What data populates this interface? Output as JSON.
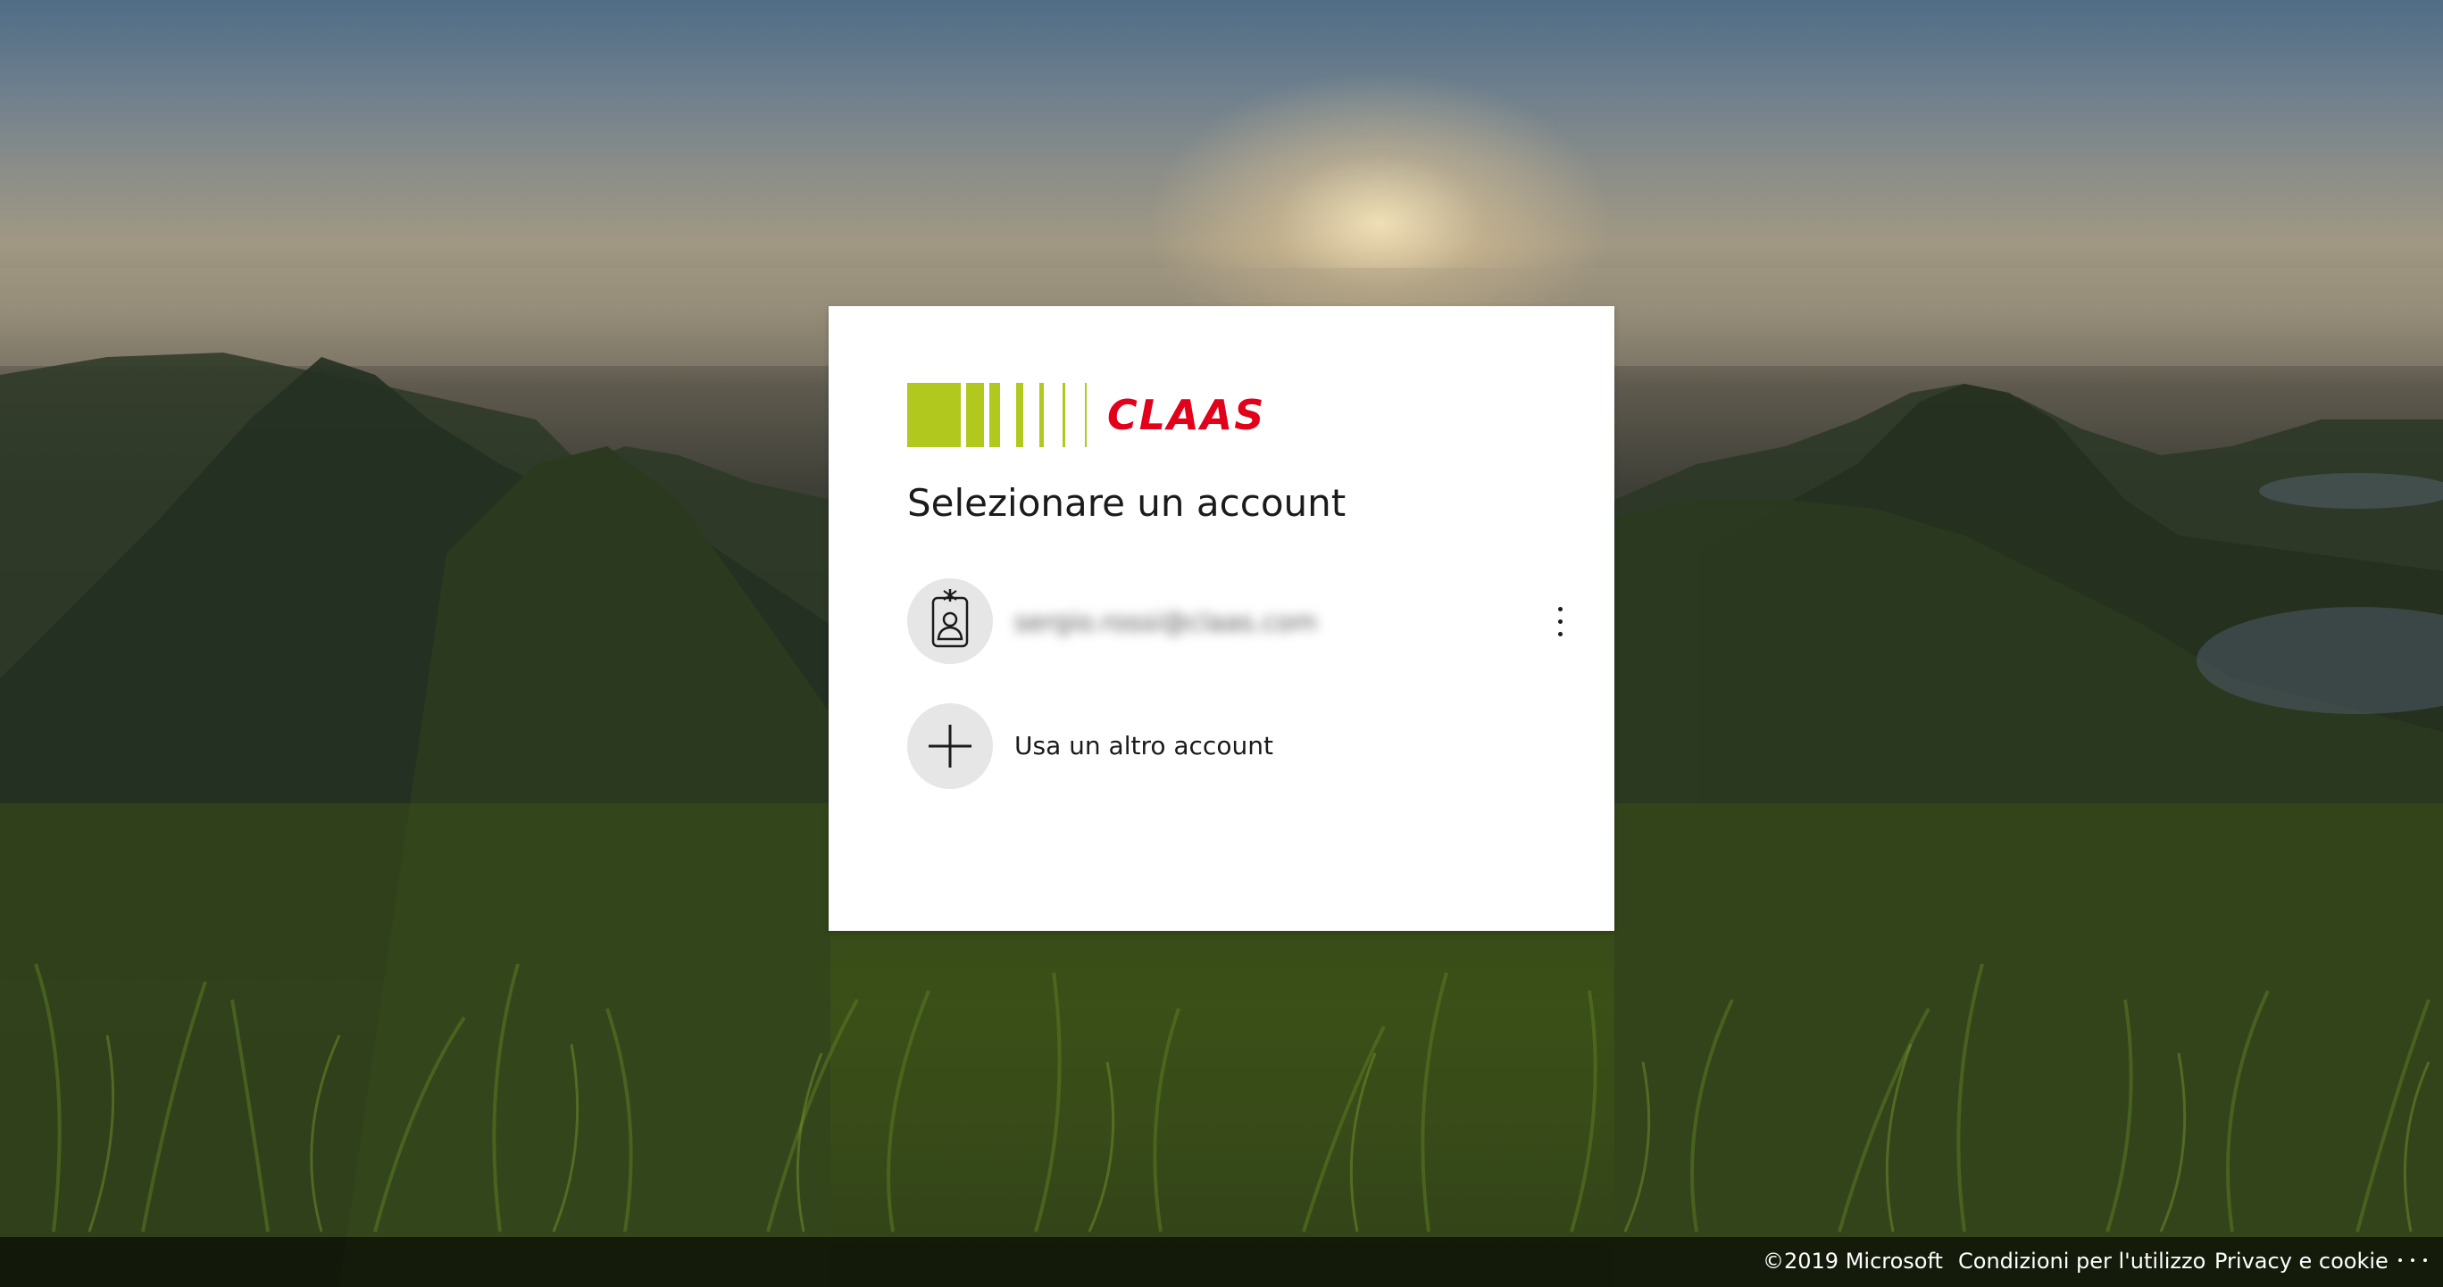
{
  "background": {
    "description_colors": {
      "sky_top": "#4f6d86",
      "sun_glow": "#ffecbe",
      "grass": "#3c5119"
    }
  },
  "card": {
    "brand": {
      "name": "CLAAS",
      "stripe_color": "#b1c81e",
      "text_color": "#e2001a"
    },
    "title": "Selezionare un account",
    "accounts": [
      {
        "icon": "badge-person-icon",
        "email": "sergio.rossi@claas.com",
        "email_obscured": true,
        "more_options_icon": "vertical-ellipsis-icon"
      }
    ],
    "use_another": {
      "icon": "plus-icon",
      "label": "Usa un altro account"
    }
  },
  "footer": {
    "copyright": "©2019 Microsoft",
    "terms": "Condizioni per l'utilizzo",
    "privacy": "Privacy e cookie",
    "more_icon": "horizontal-ellipsis-icon"
  }
}
